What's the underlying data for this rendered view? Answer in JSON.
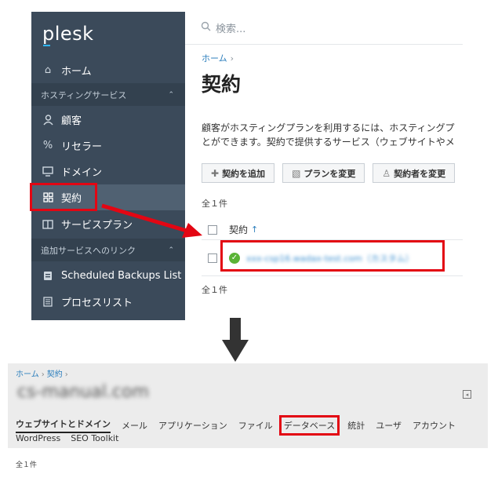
{
  "top_screen": {
    "logo": "plesk",
    "sidebar": {
      "items": [
        {
          "label": "ホーム",
          "icon": "home-icon"
        },
        {
          "label": "顧客",
          "icon": "person-icon"
        },
        {
          "label": "リセラー",
          "icon": "percent-icon"
        },
        {
          "label": "ドメイン",
          "icon": "monitor-icon"
        },
        {
          "label": "契約",
          "icon": "grid-icon",
          "active": true
        },
        {
          "label": "サービスプラン",
          "icon": "book-icon"
        },
        {
          "label": "Scheduled Backups List",
          "icon": "backup-icon"
        },
        {
          "label": "プロセスリスト",
          "icon": "list-icon"
        }
      ],
      "groups": [
        {
          "label": "ホスティングサービス"
        },
        {
          "label": "追加サービスへのリンク"
        }
      ],
      "collapse_glyph": "‹"
    },
    "search_placeholder": "検索...",
    "breadcrumb": "ホーム",
    "breadcrumb_sep": "›",
    "title": "契約",
    "description_line1": "顧客がホスティングプランを利用するには、ホスティングプ",
    "description_line2": "とができます。契約で提供するサービス（ウェブサイトやメ",
    "toolbar": {
      "add": "契約を追加",
      "change_plan": "プランを変更",
      "change_subscriber": "契約者を変更"
    },
    "count": "全１件",
    "column_header": "契約",
    "sort_arrow": "↑",
    "row_link": "xxx-csp16.wadax-test.com（カスタム）",
    "count_bottom": "全１件"
  },
  "bottom_screen": {
    "breadcrumb": [
      "ホーム",
      "契約"
    ],
    "breadcrumb_sep": "›",
    "domain": "cs-manual.com",
    "tabs": [
      "ウェブサイトとドメイン",
      "メール",
      "アプリケーション",
      "ファイル",
      "データベース",
      "統計",
      "ユーザ",
      "アカウント"
    ],
    "subtabs": [
      "WordPress",
      "SEO Toolkit"
    ],
    "count": "全１件"
  },
  "colors": {
    "sidebar_bg": "#3b4a5a",
    "highlight_red": "#e30613",
    "link_blue": "#2d7fbd",
    "status_green": "#5ab336"
  }
}
